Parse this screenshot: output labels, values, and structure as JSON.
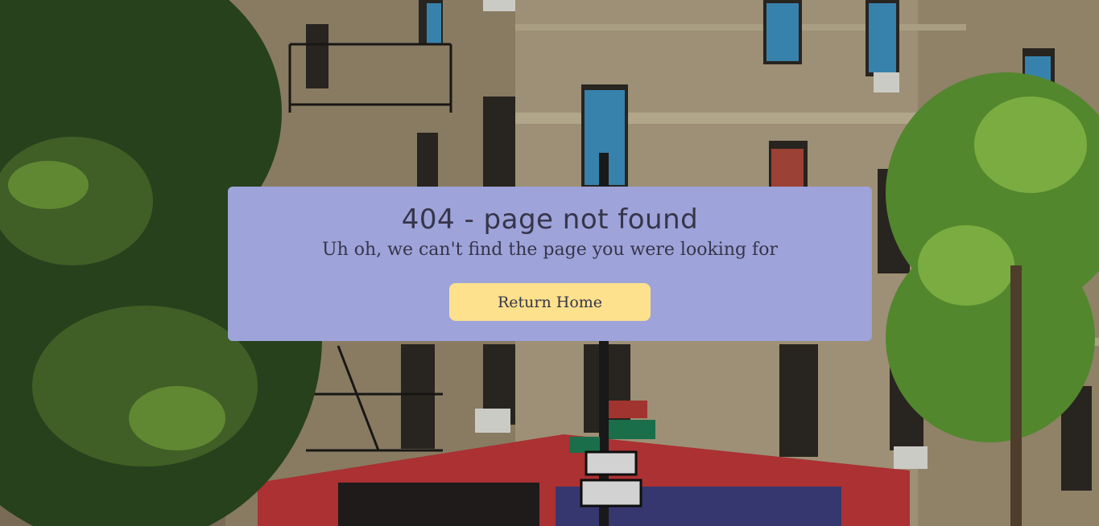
{
  "error": {
    "title": "404 - page not found",
    "message": "Uh oh, we can't find the page you were looking for",
    "home_button_label": "Return Home"
  },
  "colors": {
    "card_background": "#9ea3d9",
    "button_background": "#fde18c",
    "text": "#36354a"
  }
}
